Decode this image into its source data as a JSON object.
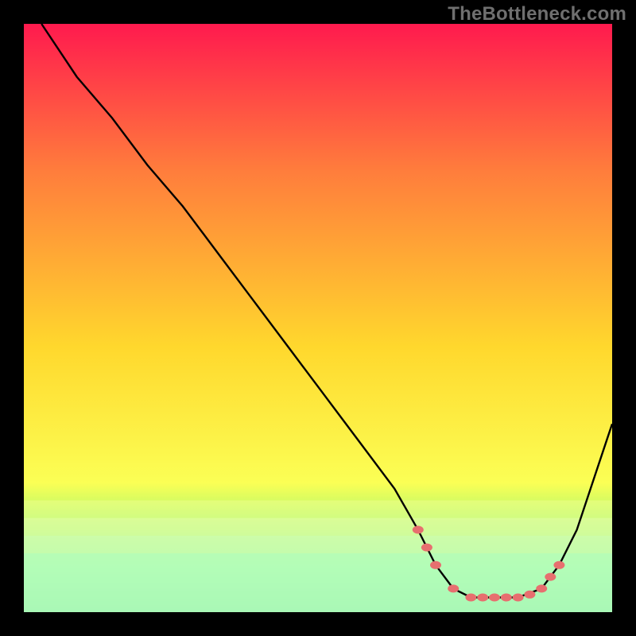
{
  "watermark": "TheBottleneck.com",
  "chart_data": {
    "type": "line",
    "title": "",
    "xlabel": "",
    "ylabel": "",
    "xlim": [
      0,
      100
    ],
    "ylim": [
      0,
      100
    ],
    "background_gradient": {
      "top": "#ff1a4e",
      "mid_upper": "#ff7d3c",
      "mid": "#ffd82d",
      "mid_lower": "#fbff55",
      "green_band": "#4df08e",
      "bottom": "#0ecf85"
    },
    "overlay_bands": [
      {
        "y": 81,
        "color": "#f5ff9a",
        "opacity": 0.45
      },
      {
        "y": 84,
        "color": "#e8ffb8",
        "opacity": 0.4
      },
      {
        "y": 87,
        "color": "#c8ffc6",
        "opacity": 0.35
      },
      {
        "y": 90,
        "color": "#9dffc9",
        "opacity": 0.35
      }
    ],
    "curve": [
      {
        "x": 3,
        "y": 0
      },
      {
        "x": 9,
        "y": 9
      },
      {
        "x": 15,
        "y": 16
      },
      {
        "x": 21,
        "y": 24
      },
      {
        "x": 27,
        "y": 31
      },
      {
        "x": 33,
        "y": 39
      },
      {
        "x": 39,
        "y": 47
      },
      {
        "x": 45,
        "y": 55
      },
      {
        "x": 51,
        "y": 63
      },
      {
        "x": 57,
        "y": 71
      },
      {
        "x": 63,
        "y": 79
      },
      {
        "x": 67,
        "y": 86
      },
      {
        "x": 70,
        "y": 92
      },
      {
        "x": 73,
        "y": 96
      },
      {
        "x": 76,
        "y": 97.5
      },
      {
        "x": 80,
        "y": 97.5
      },
      {
        "x": 84,
        "y": 97.5
      },
      {
        "x": 88,
        "y": 96
      },
      {
        "x": 91,
        "y": 92
      },
      {
        "x": 94,
        "y": 86
      },
      {
        "x": 97,
        "y": 77
      },
      {
        "x": 100,
        "y": 68
      }
    ],
    "highlight_points": [
      {
        "x": 67,
        "y": 86
      },
      {
        "x": 68.5,
        "y": 89
      },
      {
        "x": 70,
        "y": 92
      },
      {
        "x": 73,
        "y": 96
      },
      {
        "x": 76,
        "y": 97.5
      },
      {
        "x": 78,
        "y": 97.5
      },
      {
        "x": 80,
        "y": 97.5
      },
      {
        "x": 82,
        "y": 97.5
      },
      {
        "x": 84,
        "y": 97.5
      },
      {
        "x": 86,
        "y": 97
      },
      {
        "x": 88,
        "y": 96
      },
      {
        "x": 89.5,
        "y": 94
      },
      {
        "x": 91,
        "y": 92
      }
    ],
    "highlight_color": "#e76f6f",
    "curve_color": "#000000"
  }
}
